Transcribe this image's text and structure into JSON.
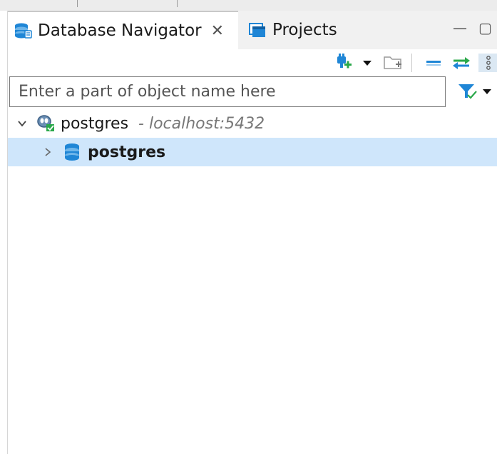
{
  "tabs": {
    "navigator_label": "Database Navigator",
    "projects_label": "Projects",
    "close_glyph": "✕"
  },
  "window_controls": {
    "minimize_glyph": "—",
    "maximize_glyph": "▢"
  },
  "filter": {
    "placeholder": "Enter a part of object name here"
  },
  "tree": {
    "connection": {
      "name": "postgres",
      "host": "- localhost:5432"
    },
    "database": {
      "name": "postgres"
    }
  },
  "colors": {
    "accent_blue": "#1f86d6",
    "accent_green": "#2aa84a",
    "selection": "#cfe6fb"
  }
}
